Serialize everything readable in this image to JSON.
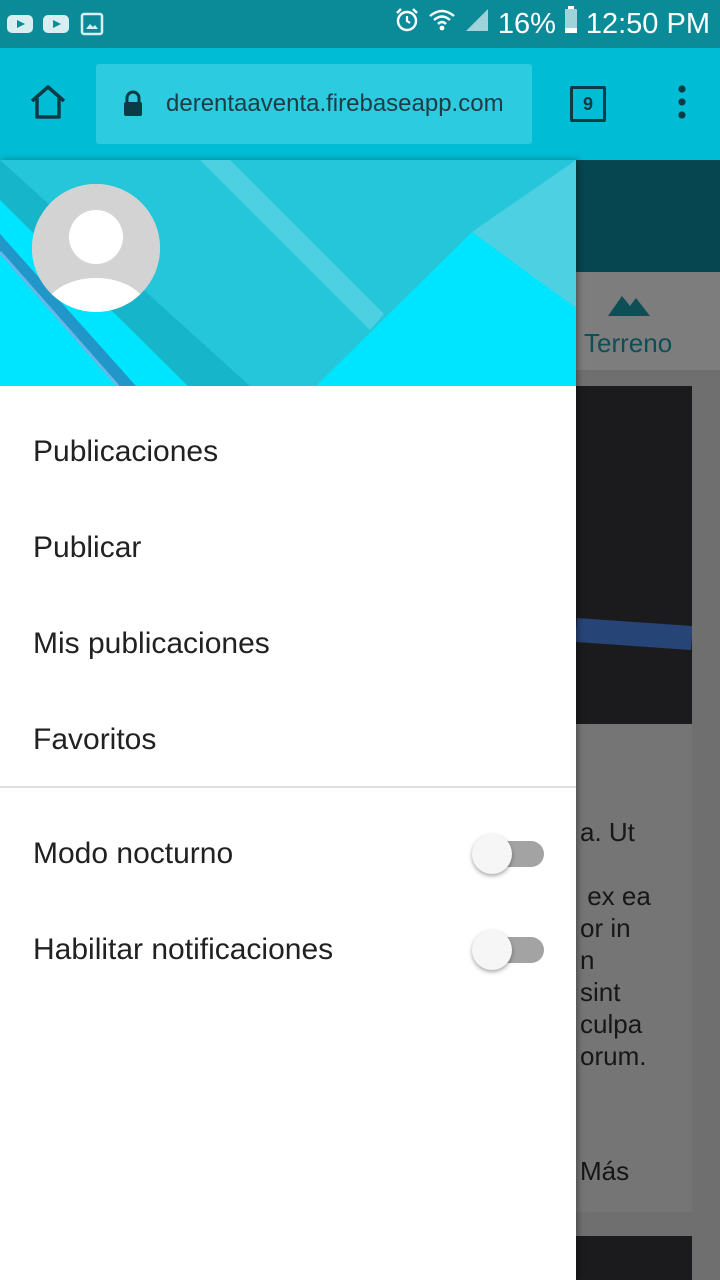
{
  "status_bar": {
    "notification_icons": [
      "youtube-icon",
      "youtube-icon",
      "image-icon"
    ],
    "battery_percent": "16%",
    "time": "12:50 PM"
  },
  "browser": {
    "url": "derentaaventa.firebaseapp.com",
    "tab_count": "9"
  },
  "page": {
    "category_tab": "Terreno",
    "card_text_fragment": "a. Ut\n\n ex ea\nor in\nn\nsint\nculpa\norum.",
    "more_link": "Más"
  },
  "drawer": {
    "nav_items": [
      {
        "label": "Publicaciones"
      },
      {
        "label": "Publicar"
      },
      {
        "label": "Mis publicaciones"
      },
      {
        "label": "Favoritos"
      }
    ],
    "settings": [
      {
        "label": "Modo nocturno",
        "enabled": false
      },
      {
        "label": "Habilitar notificaciones",
        "enabled": false
      }
    ]
  },
  "colors": {
    "status_bar": "#0b8b98",
    "toolbar": "#00bcd4",
    "drawer_header": "#00e5ff"
  }
}
